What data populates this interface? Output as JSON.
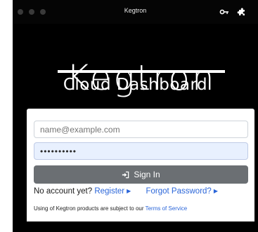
{
  "window": {
    "title": "Kegtron",
    "icons": [
      "key-icon",
      "puzzle-piece-icon"
    ]
  },
  "logo": {
    "title": "Kegtron",
    "subtitle": "Cloud Dashboard"
  },
  "form": {
    "email_placeholder": "name@example.com",
    "password_value": "••••••••••",
    "signin_label": "Sign In",
    "signin_icon": "sign-in-icon",
    "no_account_text": "No account yet?",
    "register_label": "Register",
    "forgot_label": "Forgot Password?",
    "terms_prefix": "Using of Kegtron products are subject to our",
    "terms_link": "Terms of Service"
  },
  "colors": {
    "accent": "#2b66d9",
    "button": "#6b6f73",
    "background": "#000000"
  }
}
